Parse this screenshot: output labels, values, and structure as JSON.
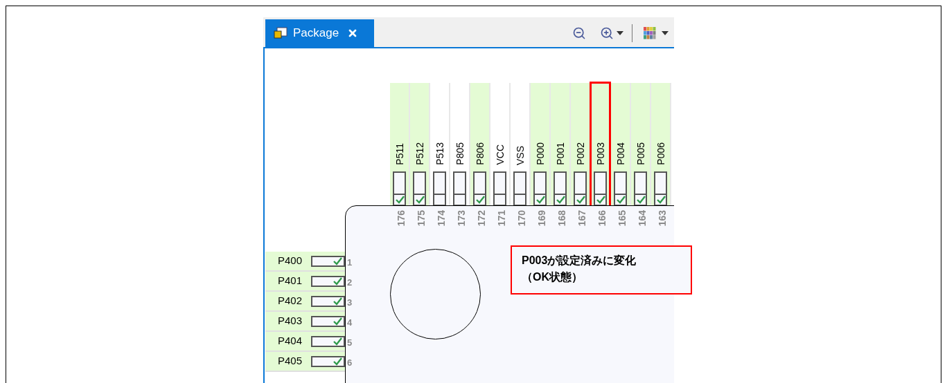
{
  "tab": {
    "label": "Package",
    "selected": true
  },
  "top_pins": [
    {
      "name": "P511",
      "number": "176",
      "configured": true,
      "highlighted": false
    },
    {
      "name": "P512",
      "number": "175",
      "configured": true,
      "highlighted": false
    },
    {
      "name": "P513",
      "number": "174",
      "configured": false,
      "highlighted": false
    },
    {
      "name": "P805",
      "number": "173",
      "configured": false,
      "highlighted": false
    },
    {
      "name": "P806",
      "number": "172",
      "configured": true,
      "highlighted": false
    },
    {
      "name": "VCC",
      "number": "171",
      "configured": false,
      "highlighted": false
    },
    {
      "name": "VSS",
      "number": "170",
      "configured": false,
      "highlighted": false
    },
    {
      "name": "P000",
      "number": "169",
      "configured": true,
      "highlighted": false
    },
    {
      "name": "P001",
      "number": "168",
      "configured": true,
      "highlighted": false
    },
    {
      "name": "P002",
      "number": "167",
      "configured": true,
      "highlighted": false
    },
    {
      "name": "P003",
      "number": "166",
      "configured": true,
      "highlighted": true
    },
    {
      "name": "P004",
      "number": "165",
      "configured": true,
      "highlighted": false
    },
    {
      "name": "P005",
      "number": "164",
      "configured": true,
      "highlighted": false
    },
    {
      "name": "P006",
      "number": "163",
      "configured": true,
      "highlighted": false
    }
  ],
  "left_pins": [
    {
      "name": "P400",
      "number": "1",
      "configured": true
    },
    {
      "name": "P401",
      "number": "2",
      "configured": true
    },
    {
      "name": "P402",
      "number": "3",
      "configured": true
    },
    {
      "name": "P403",
      "number": "4",
      "configured": true
    },
    {
      "name": "P404",
      "number": "5",
      "configured": true
    },
    {
      "name": "P405",
      "number": "6",
      "configured": true
    }
  ],
  "callout": {
    "lines": [
      "P003が設定済みに変化",
      "（OK状態）"
    ]
  }
}
